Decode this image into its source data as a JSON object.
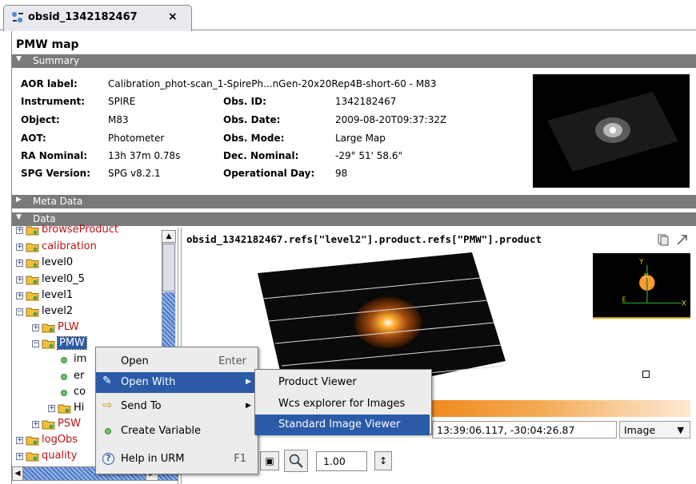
{
  "tab": {
    "title": "obsid_1342182467",
    "close": "×"
  },
  "panel_title": "PMW map",
  "sections": {
    "summary": "Summary",
    "meta": "Meta Data",
    "data": "Data"
  },
  "summary": {
    "aor_label": {
      "label": "AOR label:",
      "value": "Calibration_phot-scan_1-SpirePh...nGen-20x20Rep4B-short-60 - M83"
    },
    "instrument": {
      "label": "Instrument:",
      "value": "SPIRE"
    },
    "object": {
      "label": "Object:",
      "value": "M83"
    },
    "aot": {
      "label": "AOT:",
      "value": "Photometer"
    },
    "ra_nominal": {
      "label": "RA Nominal:",
      "value": "13h 37m 0.78s"
    },
    "spg_version": {
      "label": "SPG Version:",
      "value": "SPG v8.2.1"
    },
    "obs_id": {
      "label": "Obs. ID:",
      "value": "1342182467"
    },
    "obs_date": {
      "label": "Obs. Date:",
      "value": "2009-08-20T09:37:32Z"
    },
    "obs_mode": {
      "label": "Obs. Mode:",
      "value": "Large Map"
    },
    "dec_nominal": {
      "label": "Dec. Nominal:",
      "value": "-29° 51' 58.6\""
    },
    "operational_day": {
      "label": "Operational Day:",
      "value": "98"
    }
  },
  "tree": {
    "items": [
      {
        "label": "browseProduct",
        "color": "#b81414"
      },
      {
        "label": "calibration",
        "color": "#b81414"
      },
      {
        "label": "level0",
        "color": "#000000"
      },
      {
        "label": "level0_5",
        "color": "#000000"
      },
      {
        "label": "level1",
        "color": "#000000"
      },
      {
        "label": "level2",
        "color": "#000000"
      },
      {
        "label": "PLW",
        "color": "#b81414"
      },
      {
        "label": "PMW",
        "color": "#ffffff"
      },
      {
        "label": "im",
        "color": "#000000"
      },
      {
        "label": "er",
        "color": "#000000"
      },
      {
        "label": "co",
        "color": "#000000"
      },
      {
        "label": "Hi",
        "color": "#000000"
      },
      {
        "label": "PSW",
        "color": "#b81414"
      },
      {
        "label": "logObs",
        "color": "#b81414"
      },
      {
        "label": "quality",
        "color": "#b81414"
      }
    ]
  },
  "viewer": {
    "path": "obsid_1342182467.refs[\"level2\"].product.refs[\"PMW\"].product",
    "coords": "13:39:06.117, -30:04:26.87",
    "mode": "Image",
    "zoom": "1.00",
    "axis_y": "Y",
    "axis_x": "X",
    "axis_n": "N",
    "axis_e": "E"
  },
  "context_menu": {
    "items": [
      {
        "label": "Open",
        "accel": "Enter",
        "icon": "none",
        "submenu": false
      },
      {
        "label": "Open With",
        "accel": "",
        "icon": "pencil-icon",
        "submenu": true
      },
      {
        "label": "Send To",
        "accel": "",
        "icon": "arrow-right-icon",
        "submenu": true
      },
      {
        "label": "Create Variable",
        "accel": "",
        "icon": "green-dot-icon",
        "submenu": false
      },
      {
        "label": "Help in URM",
        "accel": "F1",
        "icon": "help-icon",
        "submenu": false
      }
    ]
  },
  "submenu": {
    "items": [
      {
        "label": "Product Viewer"
      },
      {
        "label": "Wcs explorer for Images"
      },
      {
        "label": "Standard Image Viewer"
      }
    ]
  },
  "colors": {
    "selection": "#2a5aa8",
    "section_bar": "#7a7a7a",
    "red_label": "#b81414"
  }
}
